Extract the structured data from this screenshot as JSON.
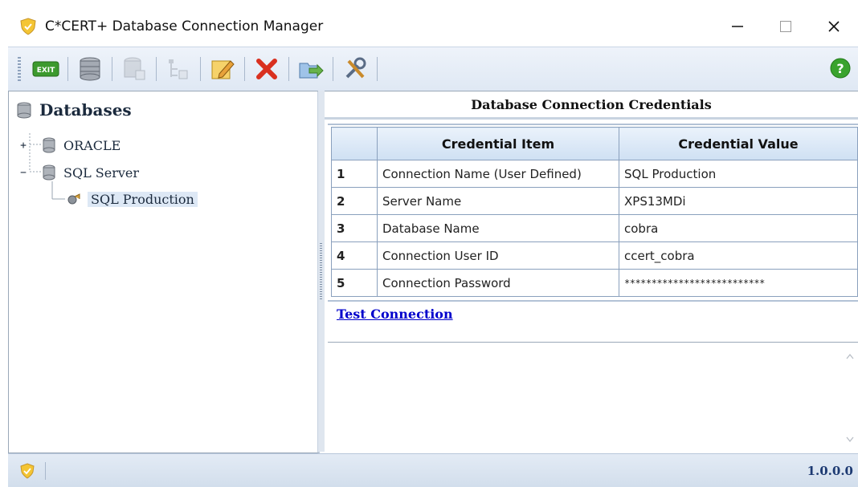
{
  "window": {
    "title": "C*CERT+ Database Connection Manager"
  },
  "toolbar": {
    "exit_label": "EXIT"
  },
  "tree": {
    "header": "Databases",
    "nodes": [
      {
        "label": "ORACLE",
        "expander": "+"
      },
      {
        "label": "SQL Server",
        "expander": "−"
      },
      {
        "label": "SQL Production"
      }
    ]
  },
  "panel": {
    "title": "Database Connection Credentials",
    "columns": [
      "Credential Item",
      "Credential Value"
    ],
    "rows": [
      {
        "num": "1",
        "item": "Connection Name (User Defined)",
        "value": "SQL Production"
      },
      {
        "num": "2",
        "item": "Server Name",
        "value": "XPS13MDi"
      },
      {
        "num": "3",
        "item": "Database Name",
        "value": "cobra"
      },
      {
        "num": "4",
        "item": "Connection User ID",
        "value": "ccert_cobra"
      },
      {
        "num": "5",
        "item": "Connection Password",
        "value": "**************************"
      }
    ],
    "test_link": "Test Connection"
  },
  "statusbar": {
    "version": "1.0.0.0"
  },
  "colors": {
    "accent_link": "#0000cc",
    "delete_red": "#d9301f",
    "help_green": "#3aa32e",
    "shield_yellow": "#f1c40f"
  }
}
